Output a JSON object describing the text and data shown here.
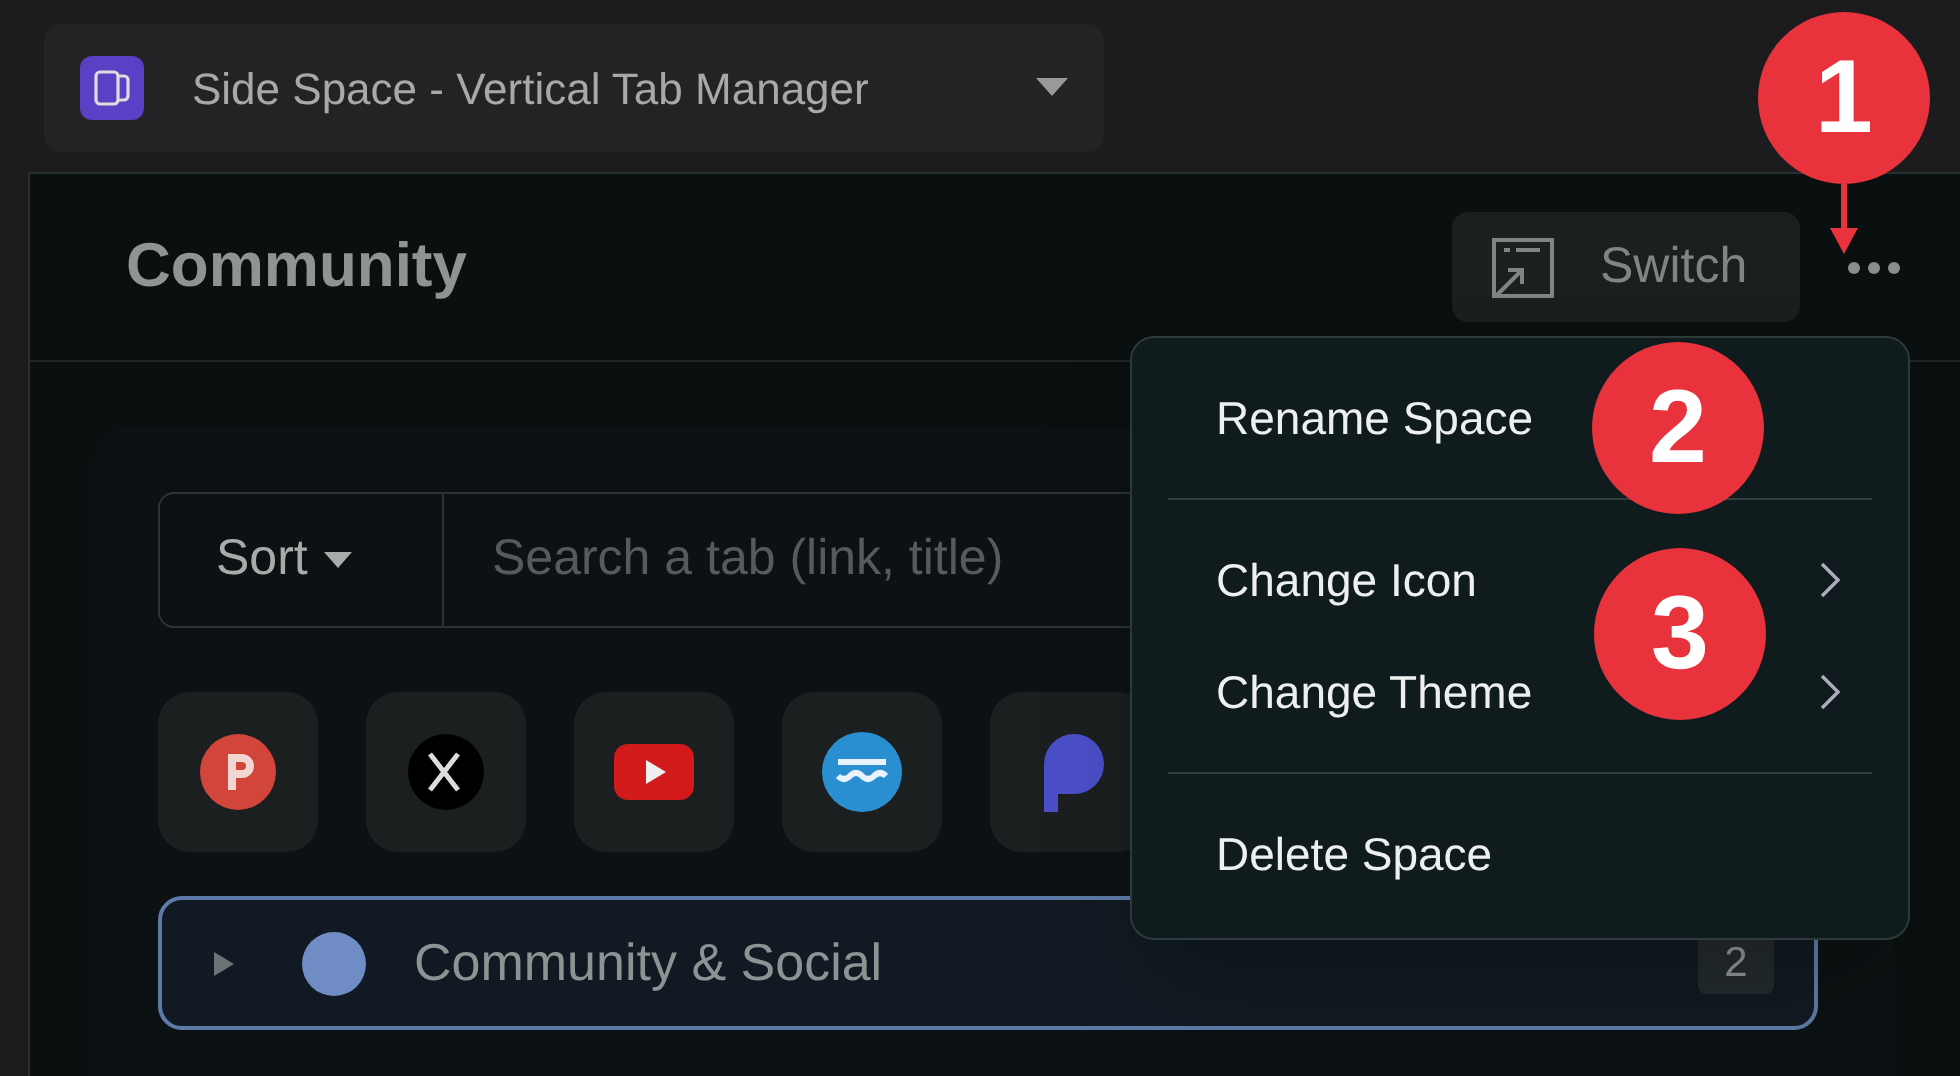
{
  "extension_picker": {
    "title": "Side Space - Vertical Tab Manager"
  },
  "space": {
    "title": "Community",
    "switch_label": "Switch"
  },
  "toolbar": {
    "sort_label": "Sort",
    "search": {
      "placeholder": "Search a tab (link, title)"
    }
  },
  "pinned_tabs": [
    {
      "kind": "letter"
    },
    {
      "kind": "x"
    },
    {
      "kind": "play"
    },
    {
      "kind": "wave"
    },
    {
      "kind": "blob"
    }
  ],
  "groups": [
    {
      "name": "Community & Social",
      "color": "#6f8cc4",
      "count": "2",
      "expanded": false
    }
  ],
  "menu": {
    "sections": [
      [
        {
          "label": "Rename Space",
          "submenu": false
        }
      ],
      [
        {
          "label": "Change Icon",
          "submenu": true
        },
        {
          "label": "Change Theme",
          "submenu": true
        }
      ],
      [
        {
          "label": "Delete Space",
          "submenu": false
        }
      ]
    ]
  },
  "annotations": [
    {
      "label": "1",
      "arrow": true
    },
    {
      "label": "2",
      "arrow": false
    },
    {
      "label": "3",
      "arrow": false
    }
  ]
}
